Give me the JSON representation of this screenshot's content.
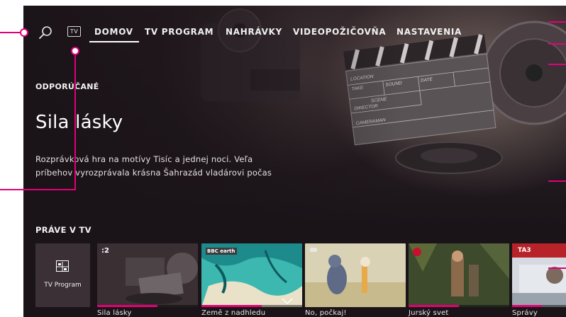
{
  "nav": {
    "tv_label": "TV",
    "items": [
      {
        "label": "DOMOV",
        "active": true
      },
      {
        "label": "TV PROGRAM"
      },
      {
        "label": "NAHRÁVKY"
      },
      {
        "label": "VIDEOPOŽIČOVŇA"
      },
      {
        "label": "NASTAVENIA"
      }
    ]
  },
  "hero": {
    "section_label": "ODPORÚČANÉ",
    "title": "Sila lásky",
    "description_line1": "Rozprávková hra na motívy Tisíc a jednej noci. Veľa",
    "description_line2": "príbehov vyrozprávala krásna Šahrazád vladárovi počas",
    "art_text": [
      "LOCATION",
      "TAKE",
      "SOUND",
      "DATE",
      "SCENE",
      "DIRECTOR",
      "CAMERAMAN"
    ]
  },
  "now_on_tv": {
    "section_label": "PRÁVE V TV",
    "program_tile_label": "TV Program",
    "tiles": [
      {
        "caption": "Sila lásky",
        "badge": ":2",
        "progress": 0.6
      },
      {
        "caption": "Země z nadhledu",
        "badge": "BBC earth",
        "progress": 0.6
      },
      {
        "caption": "No, počkaj!",
        "badge": "",
        "progress": 0.0
      },
      {
        "caption": "Jurský svet",
        "badge": "",
        "progress": 0.5
      },
      {
        "caption": "Správy",
        "badge": "TA3",
        "progress": 0.55
      }
    ]
  },
  "colors": {
    "accent": "#e20074",
    "callout": "#e2007a",
    "background": "#1d161b"
  }
}
